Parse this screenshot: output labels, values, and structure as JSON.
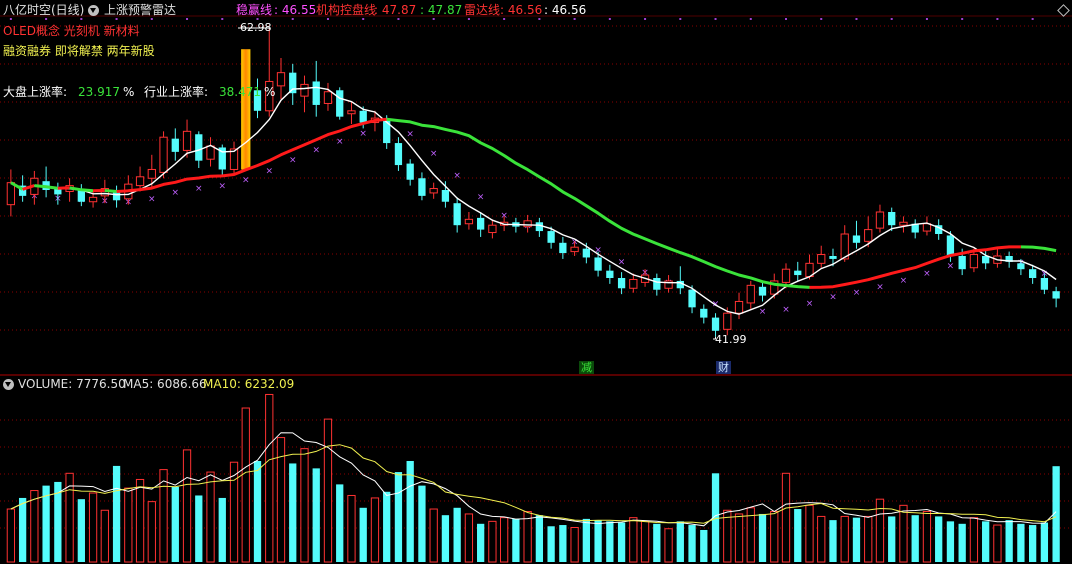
{
  "header": {
    "stock_title": "八亿时空(日线)",
    "indicator_name": "上涨预警雷达",
    "wen_ying_label": "稳赢线",
    "wen_ying_value": ": 46.55",
    "ji_gou_label": "机构控盘线",
    "ji_gou_value": ": 47.87",
    "extra_value": ": 47.87",
    "lei_da_label": "雷达线",
    "lei_da_value": ": 46.56",
    "last_value": ": 46.56"
  },
  "concepts": {
    "line1": "OLED概念 光刻机 新材料",
    "line2": "融资融券 即将解禁 两年新股"
  },
  "rise_rates": {
    "market_label": "大盘上涨率:",
    "market_value": "23.917",
    "market_unit": "%",
    "industry_label": "行业上涨率:",
    "industry_value": "38.471",
    "industry_unit": "%"
  },
  "annotations": {
    "high_label": "62.98",
    "low_label": "41.99",
    "event_jian": "减",
    "event_cai": "财"
  },
  "volume_header": {
    "volume_label": "VOLUME: 7776.50",
    "ma5_label": "MA5: 6086.66",
    "ma10_label": "MA10: 6232.09"
  },
  "colors": {
    "up": "#ff3232",
    "down": "#54fcfc",
    "ma_white": "#ffffff",
    "ma_red": "#ff1a1a",
    "ma_green": "#3ae33a",
    "cross": "#c060ff",
    "ma5_vol": "#ffffff",
    "ma10_vol": "#f0f050",
    "grid": "#8a0000"
  },
  "chart_data": {
    "type": "candlestick",
    "count": 90,
    "price_range": [
      40,
      64
    ],
    "price_high": 62.98,
    "price_low": 41.99,
    "candles": [
      [
        51.0,
        52.5,
        50.2,
        53.4
      ],
      [
        52.3,
        51.6,
        51.2,
        53.0
      ],
      [
        51.7,
        52.8,
        51.0,
        53.3
      ],
      [
        52.6,
        52.0,
        51.5,
        53.6
      ],
      [
        52.1,
        51.7,
        51.0,
        52.5
      ],
      [
        51.9,
        52.3,
        51.2,
        52.8
      ],
      [
        52.1,
        51.2,
        50.9,
        52.4
      ],
      [
        51.2,
        51.5,
        50.8,
        52.0
      ],
      [
        51.6,
        52.1,
        51.1,
        52.7
      ],
      [
        52.0,
        51.3,
        50.8,
        52.3
      ],
      [
        51.4,
        52.4,
        51.0,
        53.0
      ],
      [
        52.3,
        52.9,
        51.9,
        53.6
      ],
      [
        52.8,
        53.4,
        52.2,
        54.4
      ],
      [
        53.2,
        55.6,
        52.8,
        56.0
      ],
      [
        55.5,
        54.6,
        54.0,
        56.2
      ],
      [
        54.7,
        56.0,
        54.2,
        56.8
      ],
      [
        55.8,
        54.0,
        53.5,
        56.0
      ],
      [
        54.1,
        55.0,
        53.6,
        55.6
      ],
      [
        54.9,
        53.4,
        53.0,
        55.1
      ],
      [
        53.4,
        54.8,
        53.0,
        55.3
      ],
      [
        54.6,
        59.0,
        54.2,
        59.8
      ],
      [
        58.8,
        57.4,
        56.9,
        59.6
      ],
      [
        57.4,
        59.4,
        57.0,
        62.98
      ],
      [
        59.1,
        60.0,
        58.2,
        61.0
      ],
      [
        60.0,
        58.6,
        57.8,
        60.6
      ],
      [
        58.4,
        59.2,
        57.3,
        59.8
      ],
      [
        59.4,
        57.8,
        57.0,
        60.8
      ],
      [
        57.9,
        58.7,
        57.4,
        59.3
      ],
      [
        58.8,
        57.0,
        56.8,
        59.0
      ],
      [
        57.2,
        57.4,
        56.5,
        58.0
      ],
      [
        57.4,
        56.6,
        56.2,
        57.7
      ],
      [
        56.6,
        56.9,
        56.0,
        57.4
      ],
      [
        56.8,
        55.2,
        54.8,
        57.1
      ],
      [
        55.2,
        53.7,
        53.3,
        55.6
      ],
      [
        53.8,
        52.7,
        52.3,
        54.1
      ],
      [
        52.8,
        51.6,
        51.3,
        53.2
      ],
      [
        51.8,
        52.1,
        51.4,
        52.5
      ],
      [
        52.0,
        51.2,
        50.8,
        52.6
      ],
      [
        51.1,
        49.6,
        49.1,
        51.5
      ],
      [
        49.7,
        50.0,
        49.3,
        50.5
      ],
      [
        50.1,
        49.3,
        48.8,
        50.5
      ],
      [
        49.1,
        49.6,
        48.7,
        50.0
      ],
      [
        49.6,
        49.8,
        49.2,
        50.2
      ],
      [
        49.8,
        49.5,
        49.1,
        50.1
      ],
      [
        49.5,
        49.9,
        49.1,
        50.3
      ],
      [
        49.8,
        49.2,
        48.8,
        50.1
      ],
      [
        49.2,
        48.4,
        48.0,
        49.5
      ],
      [
        48.4,
        47.7,
        47.3,
        48.8
      ],
      [
        47.8,
        48.1,
        47.5,
        48.5
      ],
      [
        48.0,
        47.4,
        47.0,
        48.4
      ],
      [
        47.4,
        46.5,
        46.1,
        47.8
      ],
      [
        46.5,
        46.0,
        45.6,
        46.9
      ],
      [
        46.0,
        45.3,
        44.9,
        46.4
      ],
      [
        45.3,
        45.9,
        45.0,
        46.3
      ],
      [
        45.7,
        46.2,
        45.4,
        46.6
      ],
      [
        46.0,
        45.2,
        44.8,
        46.3
      ],
      [
        45.3,
        45.8,
        45.0,
        46.2
      ],
      [
        45.8,
        45.3,
        44.9,
        46.8
      ],
      [
        45.2,
        44.0,
        43.6,
        45.5
      ],
      [
        43.9,
        43.3,
        42.9,
        44.2
      ],
      [
        43.3,
        42.4,
        41.99,
        43.6
      ],
      [
        42.5,
        43.6,
        42.1,
        44.0
      ],
      [
        43.6,
        44.4,
        43.2,
        45.0
      ],
      [
        44.3,
        45.5,
        43.9,
        45.8
      ],
      [
        45.4,
        44.8,
        44.4,
        45.8
      ],
      [
        44.9,
        45.8,
        44.6,
        46.3
      ],
      [
        45.7,
        46.6,
        45.3,
        47.0
      ],
      [
        46.5,
        46.2,
        45.8,
        47.1
      ],
      [
        46.1,
        47.0,
        45.9,
        47.6
      ],
      [
        47.0,
        47.6,
        46.7,
        48.2
      ],
      [
        47.5,
        47.3,
        46.8,
        48.0
      ],
      [
        47.3,
        49.0,
        47.1,
        49.6
      ],
      [
        48.9,
        48.4,
        48.0,
        49.9
      ],
      [
        48.5,
        49.3,
        48.1,
        50.2
      ],
      [
        49.4,
        50.5,
        49.1,
        51.0
      ],
      [
        50.5,
        49.6,
        49.2,
        50.8
      ],
      [
        49.6,
        49.8,
        49.1,
        50.2
      ],
      [
        49.7,
        49.1,
        48.7,
        50.0
      ],
      [
        49.2,
        49.7,
        48.9,
        50.2
      ],
      [
        49.6,
        49.0,
        48.6,
        50.0
      ],
      [
        48.9,
        47.5,
        47.1,
        49.2
      ],
      [
        47.5,
        46.6,
        46.2,
        48.0
      ],
      [
        46.7,
        47.6,
        46.4,
        48.0
      ],
      [
        47.5,
        47.0,
        46.6,
        47.9
      ],
      [
        47.0,
        47.5,
        46.7,
        48.1
      ],
      [
        47.5,
        47.1,
        46.7,
        47.8
      ],
      [
        47.0,
        46.6,
        46.2,
        47.3
      ],
      [
        46.6,
        46.0,
        45.6,
        46.9
      ],
      [
        46.0,
        45.2,
        44.9,
        46.3
      ],
      [
        45.1,
        44.6,
        44.0,
        45.4
      ]
    ],
    "volume": [
      4300,
      5200,
      5800,
      6200,
      6500,
      7200,
      5100,
      5600,
      4200,
      7800,
      6000,
      6700,
      4900,
      7500,
      6100,
      9100,
      5400,
      7300,
      5200,
      8100,
      12500,
      8200,
      13600,
      10100,
      8000,
      9200,
      7600,
      11600,
      6300,
      5400,
      4400,
      5200,
      5700,
      7300,
      8200,
      6200,
      4300,
      3800,
      4400,
      3900,
      3100,
      3300,
      3600,
      3500,
      4100,
      3800,
      2900,
      3000,
      2800,
      3500,
      3400,
      3300,
      3200,
      3600,
      3300,
      3100,
      2700,
      3300,
      3000,
      2600,
      7200,
      4200,
      3900,
      4400,
      3900,
      4100,
      7200,
      4300,
      4600,
      3700,
      3400,
      3700,
      3600,
      3700,
      5100,
      3700,
      4600,
      3800,
      4100,
      3700,
      3300,
      3100,
      3600,
      3300,
      3000,
      3400,
      3100,
      3000,
      3200,
      7776.5
    ],
    "volume_range": [
      0,
      13800
    ],
    "event_markers": [
      {
        "label": "减",
        "index": 66
      },
      {
        "label": "财",
        "index": 80
      }
    ]
  }
}
